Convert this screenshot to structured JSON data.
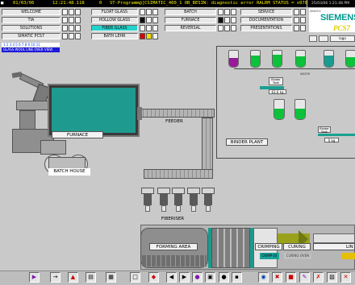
{
  "status": {
    "date": "01/03/06",
    "time": "12:21:48.118",
    "code": "0",
    "message": "ST-Programm@[CSIMATIC_400_1  OB_BESIN: diagnostic error RALRM STATUS = x07800"
  },
  "clock": "25/03/06 1:21:48 PM",
  "nav": {
    "col1": [
      "WELCOME",
      "TIA",
      "SOLUTIONS",
      "SIMATIC PCS7"
    ],
    "col2": [
      "FLOAT GLASS",
      "HOLLOW GLASS",
      "FIBER GLASS",
      "BATH LEHR"
    ],
    "col3": [
      "BATCH",
      "FURNACE",
      "REVERSAL"
    ],
    "col4": [
      "SERVICE",
      "DOCUMENTATION",
      "PRESENTATIONS"
    ],
    "active": "FIBER GLASS"
  },
  "brand": {
    "name": "SIEMENS",
    "product": "PCS7",
    "sub": "SIMATIC",
    "small": "logo"
  },
  "overview": {
    "numbers": "1 2 3 4 5 6 7 8 9 10 11",
    "label": "GLASS WOOL LINE OVER VIEW"
  },
  "process": {
    "furnace": "FURNACE",
    "feeder": "FEEDER",
    "batch_house": "BATCH HOUSE",
    "binder_plant": "BINDER PLANT",
    "fiberiser": "FIBERISER",
    "forming_area": "FORMING AREA",
    "crimping": "CRIMPING",
    "curing": "CURING",
    "lin": "LIN",
    "crimp_sub": "CRIMP 03",
    "curing_sub": "CURING OVEN",
    "tank1_label": "Binder Tank",
    "tank1_value": "63.6 kg",
    "tank2_label": "Binder Tank",
    "tank2_value": "0 kg",
    "water": "WATER"
  },
  "silo_levels": {
    "s1": 0.55,
    "s2": 0.7,
    "s3": 0.75,
    "s4": 0.65,
    "s5": 0.72,
    "s6": 0.6,
    "s7": 0.55,
    "s8": 0.55
  },
  "colors": {
    "accent": "#24d2cc",
    "status_text": "#f4f000",
    "furnace": "#1f9a8e",
    "binder": "#0bc23a"
  },
  "toolbar": {
    "icons": [
      "play-icon",
      "arrow-right-icon",
      "trend-icon",
      "copy-icon",
      "print-icon",
      "folder-icon",
      "alarm-icon",
      "previous-icon",
      "next-icon",
      "info-icon",
      "screen-icon",
      "key-icon",
      "lock-icon",
      "help-icon",
      "user-icon",
      "exit-icon"
    ]
  }
}
